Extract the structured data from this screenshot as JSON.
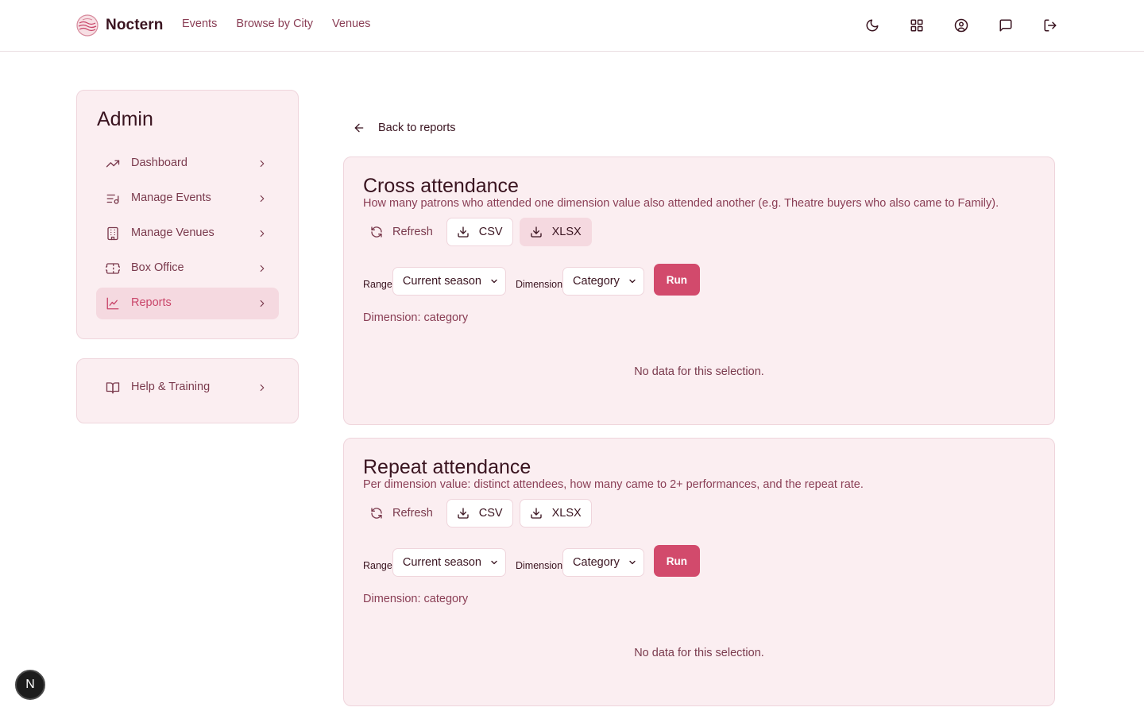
{
  "header": {
    "brand": "Noctern",
    "nav": [
      "Events",
      "Browse by City",
      "Venues"
    ],
    "icons": [
      "moon-icon",
      "grid-icon",
      "user-circle-icon",
      "message-icon",
      "logout-icon"
    ]
  },
  "sidebar": {
    "title": "Admin",
    "items": [
      {
        "label": "Dashboard",
        "icon": "trending-up-icon"
      },
      {
        "label": "Manage Events",
        "icon": "list-music-icon"
      },
      {
        "label": "Manage Venues",
        "icon": "building-icon"
      },
      {
        "label": "Box Office",
        "icon": "ticket-icon"
      },
      {
        "label": "Reports",
        "icon": "line-chart-icon",
        "active": true
      }
    ],
    "help": {
      "label": "Help & Training",
      "icon": "book-open-icon"
    }
  },
  "back_label": "Back to reports",
  "reports": [
    {
      "title": "Cross attendance",
      "description": "How many patrons who attended one dimension value also attended another (e.g. Theatre buyers who also came to Family).",
      "buttons": {
        "refresh": "Refresh",
        "csv": "CSV",
        "xlsx": "XLSX"
      },
      "range_label": "Range",
      "range_value": "Current season",
      "dimension_label": "Dimension",
      "dimension_value": "Category",
      "run_label": "Run",
      "dimension_text": "Dimension: category",
      "empty_text": "No data for this selection."
    },
    {
      "title": "Repeat attendance",
      "description": "Per dimension value: distinct attendees, how many came to 2+ performances, and the repeat rate.",
      "buttons": {
        "refresh": "Refresh",
        "csv": "CSV",
        "xlsx": "XLSX"
      },
      "range_label": "Range",
      "range_value": "Current season",
      "dimension_label": "Dimension",
      "dimension_value": "Category",
      "run_label": "Run",
      "dimension_text": "Dimension: category",
      "empty_text": "No data for this selection."
    }
  ],
  "badge_letter": "N",
  "colors": {
    "accent": "#d24a6c",
    "card_bg": "#fbeef1",
    "active_bg": "#f5d9e0",
    "text": "#3a1420"
  }
}
